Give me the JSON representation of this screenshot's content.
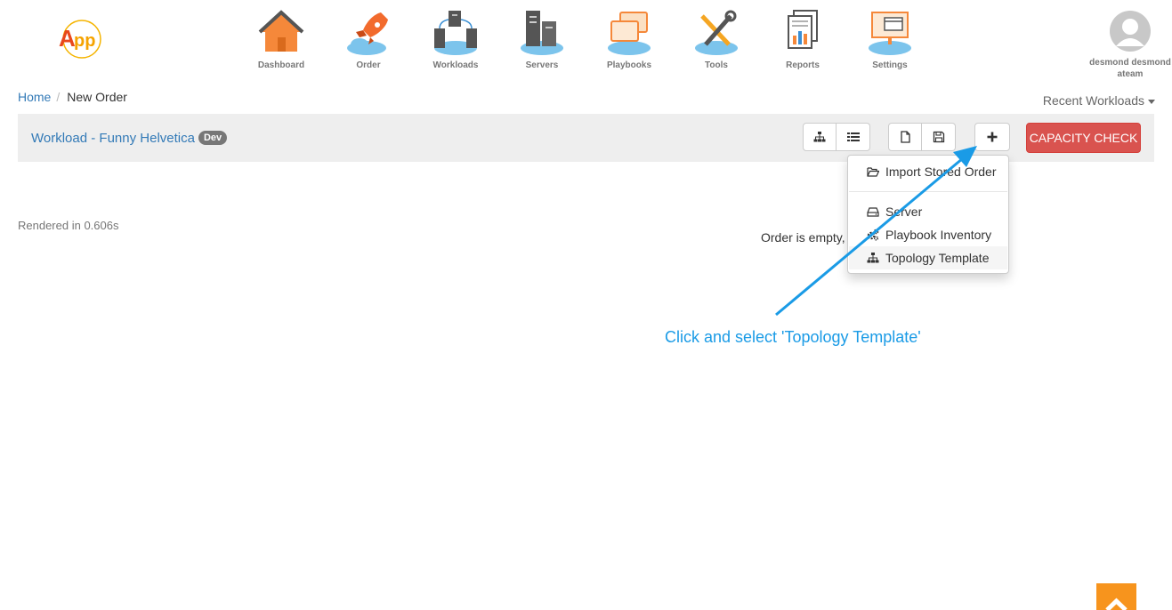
{
  "logo": {
    "text": "App"
  },
  "nav": [
    {
      "label": "Dashboard"
    },
    {
      "label": "Order"
    },
    {
      "label": "Workloads"
    },
    {
      "label": "Servers"
    },
    {
      "label": "Playbooks"
    },
    {
      "label": "Tools"
    },
    {
      "label": "Reports"
    },
    {
      "label": "Settings"
    }
  ],
  "user": {
    "name": "desmond desmond",
    "team": "ateam"
  },
  "breadcrumb": {
    "home": "Home",
    "current": "New Order"
  },
  "recent_workloads": "Recent Workloads",
  "workload": {
    "title": "Workload - Funny Helvetica",
    "badge": "Dev"
  },
  "toolbar": {
    "capacity_check": "CAPACITY CHECK"
  },
  "dropdown": {
    "items": [
      {
        "label": "Import Stored Order",
        "icon": "folder-open-icon"
      },
      {
        "label": "Server",
        "icon": "hdd-icon"
      },
      {
        "label": "Playbook Inventory",
        "icon": "cogs-icon"
      },
      {
        "label": "Topology Template",
        "icon": "sitemap-icon"
      }
    ]
  },
  "rendered_text": "Rendered in 0.606s",
  "empty_message": "Order is empty, a",
  "annotation": "Click and select 'Topology Template'",
  "colors": {
    "link": "#337ab7",
    "danger": "#d9534f",
    "annotation": "#1a9be6",
    "accent": "#f7941d"
  }
}
